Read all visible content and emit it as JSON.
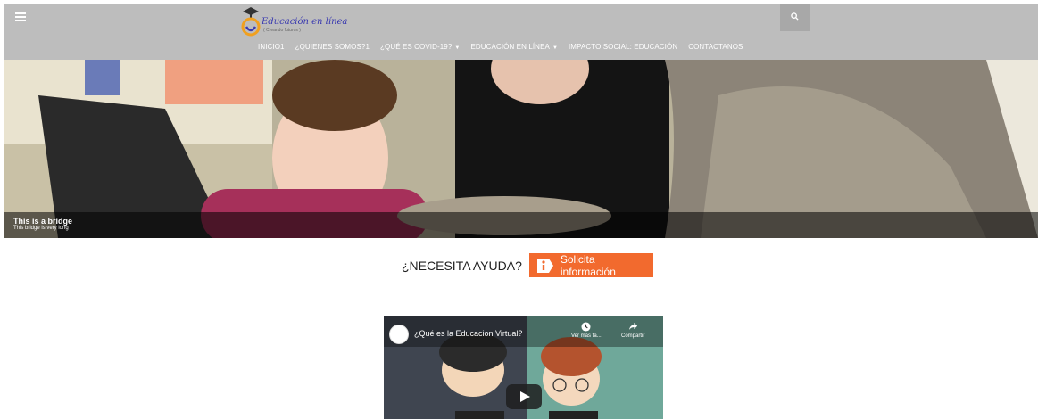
{
  "nav": {
    "logo": {
      "text": "Educación en línea",
      "sub": "( Creando futuros )"
    },
    "menu": [
      {
        "label": "INICIO1",
        "dropdown": false
      },
      {
        "label": "¿QUIENES SOMOS?1",
        "dropdown": false
      },
      {
        "label": "¿QUÉ ES COVID-19?",
        "dropdown": true
      },
      {
        "label": "EDUCACIÓN EN LÍNEA",
        "dropdown": true
      },
      {
        "label": "IMPACTO SOCIAL: EDUCACIÓN",
        "dropdown": false
      },
      {
        "label": "CONTACTANOS",
        "dropdown": false
      }
    ]
  },
  "hero": {
    "caption_title": "This is a bridge",
    "caption_sub": "This bridge is very long"
  },
  "help": {
    "label": "¿NECESITA AYUDA?",
    "button": "Solicita información"
  },
  "video": {
    "title": "¿Qué es la Educacion Virtual?",
    "watch_later": "Ver más ta...",
    "share": "Compartir"
  },
  "colors": {
    "nav_bg": "#bdbdbd",
    "accent": "#f26a2e"
  }
}
